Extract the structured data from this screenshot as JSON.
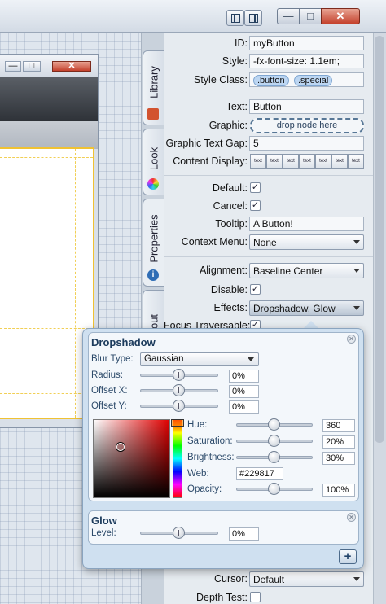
{
  "window_controls": {
    "minimize": "—",
    "maximize": "□",
    "close": "✕"
  },
  "tabs": [
    {
      "label": "Library",
      "icon": "library-icon",
      "color": "#d2532f"
    },
    {
      "label": "Look",
      "icon": "look-icon",
      "color": "#6aa84f"
    },
    {
      "label": "Properties",
      "icon": "properties-icon",
      "color": "#2f6db5"
    },
    {
      "label": "Layout",
      "visible_label": "out"
    }
  ],
  "properties": {
    "id": {
      "label": "ID:",
      "value": "myButton"
    },
    "style": {
      "label": "Style:",
      "value": "-fx-font-size: 1.1em;"
    },
    "style_class": {
      "label": "Style Class:",
      "values": [
        ".button",
        ".special"
      ]
    },
    "text": {
      "label": "Text:",
      "value": "Button"
    },
    "graphic": {
      "label": "Graphic:",
      "placeholder": "drop node here"
    },
    "graphic_text_gap": {
      "label": "Graphic Text Gap:",
      "value": "5"
    },
    "content_display": {
      "label": "Content Display:",
      "options": [
        "text",
        "text",
        "text",
        "text",
        "text",
        "text",
        "text"
      ]
    },
    "default": {
      "label": "Default:",
      "checked": "✓"
    },
    "cancel": {
      "label": "Cancel:",
      "checked": "✓"
    },
    "tooltip": {
      "label": "Tooltip:",
      "value": "A Button!"
    },
    "context_menu": {
      "label": "Context Menu:",
      "value": "None"
    },
    "alignment": {
      "label": "Alignment:",
      "value": "Baseline Center"
    },
    "disable": {
      "label": "Disable:",
      "checked": "✓"
    },
    "effects": {
      "label": "Effects:",
      "value": "Dropshadow, Glow"
    },
    "focus_traversable": {
      "label": "Focus Traversable:",
      "checked": "✓"
    },
    "cursor": {
      "label": "Cursor:",
      "value": "Default"
    },
    "depth_test": {
      "label": "Depth Test:"
    }
  },
  "dropshadow": {
    "title": "Dropshadow",
    "blur_type": {
      "label": "Blur Type:",
      "value": "Gaussian"
    },
    "radius": {
      "label": "Radius:",
      "value": "0%",
      "level": 0.5
    },
    "offset_x": {
      "label": "Offset X:",
      "value": "0%",
      "level": 0.5
    },
    "offset_y": {
      "label": "Offset Y:",
      "value": "0%",
      "level": 0.5
    },
    "color": {
      "hue": {
        "label": "Hue:",
        "value": "360",
        "level": 0.5
      },
      "saturation": {
        "label": "Saturation:",
        "value": "20%",
        "level": 0.5
      },
      "brightness": {
        "label": "Brightness:",
        "value": "30%",
        "level": 0.5
      },
      "web": {
        "label": "Web:",
        "value": "#229817"
      },
      "opacity": {
        "label": "Opacity:",
        "value": "100%",
        "level": 0.5
      }
    }
  },
  "glow": {
    "title": "Glow",
    "level": {
      "label": "Level:",
      "value": "0%",
      "level": 0.5
    }
  },
  "add_button": "+"
}
